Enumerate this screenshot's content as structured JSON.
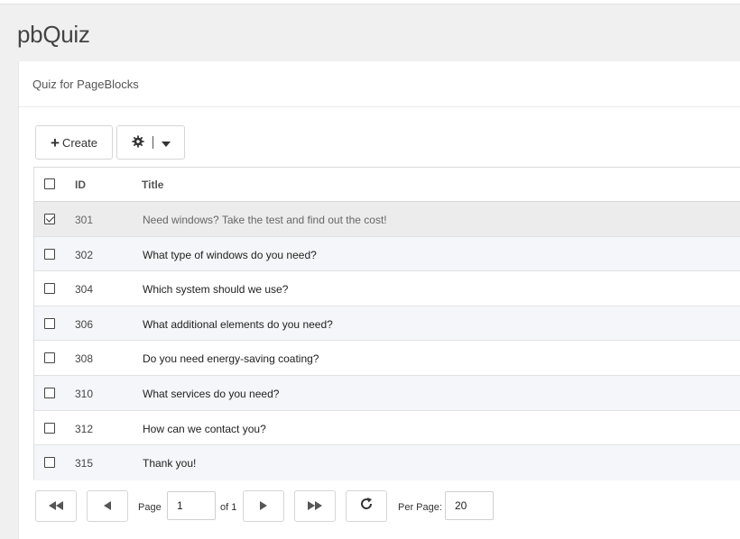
{
  "app": {
    "title": "pbQuiz"
  },
  "panel": {
    "title": "Quiz for PageBlocks"
  },
  "toolbar": {
    "create_label": "Create"
  },
  "grid": {
    "columns": {
      "id": "ID",
      "title": "Title"
    },
    "rows": [
      {
        "id": "301",
        "title": "Need windows? Take the test and find out the cost!",
        "checked": true
      },
      {
        "id": "302",
        "title": "What type of windows do you need?",
        "checked": false
      },
      {
        "id": "304",
        "title": "Which system should we use?",
        "checked": false
      },
      {
        "id": "306",
        "title": "What additional elements do you need?",
        "checked": false
      },
      {
        "id": "308",
        "title": "Do you need energy-saving coating?",
        "checked": false
      },
      {
        "id": "310",
        "title": "What services do you need?",
        "checked": false
      },
      {
        "id": "312",
        "title": "How can we contact you?",
        "checked": false
      },
      {
        "id": "315",
        "title": "Thank you!",
        "checked": false
      }
    ]
  },
  "pager": {
    "page_label": "Page",
    "page_value": "1",
    "of_label": "of 1",
    "per_page_label": "Per Page:",
    "per_page_value": "20"
  },
  "icons": {
    "create": "plus-icon",
    "settings": "gear-icon",
    "dropdown": "caret-down-icon",
    "first": "first-page-icon",
    "prev": "prev-page-icon",
    "next": "next-page-icon",
    "last": "last-page-icon",
    "refresh": "refresh-icon"
  }
}
